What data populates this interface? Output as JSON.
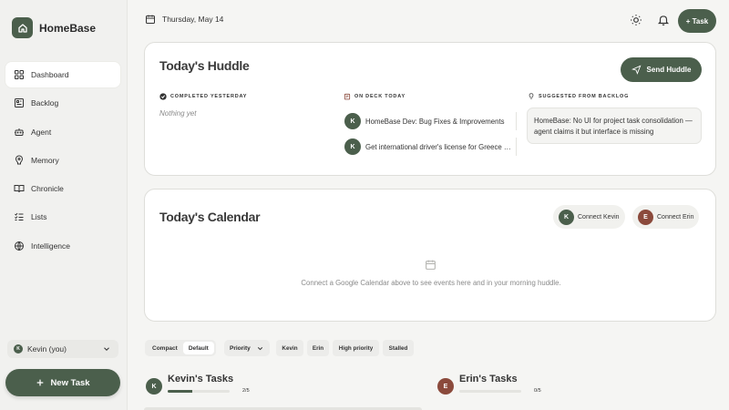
{
  "brand": {
    "name": "HomeBase"
  },
  "sidebar": {
    "items": [
      {
        "label": "Dashboard",
        "icon": "grid-icon",
        "active": true
      },
      {
        "label": "Backlog",
        "icon": "backlog-icon"
      },
      {
        "label": "Agent",
        "icon": "robot-icon"
      },
      {
        "label": "Memory",
        "icon": "memory-icon"
      },
      {
        "label": "Chronicle",
        "icon": "book-icon"
      },
      {
        "label": "Lists",
        "icon": "list-check-icon"
      },
      {
        "label": "Intelligence",
        "icon": "globe-icon"
      }
    ],
    "user": {
      "initial": "K",
      "label": "Kevin (you)"
    },
    "new_task_label": "New Task"
  },
  "topbar": {
    "date": "Thursday, May 14",
    "add_task_label": "+ Task"
  },
  "huddle": {
    "title": "Today's Huddle",
    "send_label": "Send Huddle",
    "completed": {
      "header": "COMPLETED YESTERDAY",
      "empty": "Nothing yet"
    },
    "on_deck": {
      "header": "ON DECK TODAY",
      "items": [
        {
          "initial": "K",
          "text": "HomeBase Dev: Bug Fixes & Improvements"
        },
        {
          "initial": "K",
          "text": "Get international driver's license for Greece …"
        }
      ]
    },
    "suggested": {
      "header": "SUGGESTED FROM BACKLOG",
      "text": "HomeBase: No UI for project task consolidation — agent claims it but interface is missing"
    }
  },
  "calendar": {
    "title": "Today's Calendar",
    "connect": [
      {
        "initial": "K",
        "label": "Connect Kevin"
      },
      {
        "initial": "E",
        "label": "Connect Erin"
      }
    ],
    "empty": "Connect a Google Calendar above to see events here and in your morning huddle."
  },
  "filters": {
    "view": {
      "compact": "Compact",
      "default": "Default"
    },
    "sort": "Priority",
    "chips": [
      "Kevin",
      "Erin",
      "High priority",
      "Stalled"
    ]
  },
  "tasks": {
    "kevin": {
      "initial": "K",
      "title": "Kevin's Tasks",
      "done": 2,
      "total": 5,
      "label": "2/5"
    },
    "erin": {
      "initial": "E",
      "title": "Erin's Tasks",
      "done": 0,
      "total": 5,
      "label": "0/5"
    }
  },
  "colors": {
    "accent": "#4b5f4c",
    "erin": "#8b4a3c",
    "background": "#f5f5f3"
  }
}
